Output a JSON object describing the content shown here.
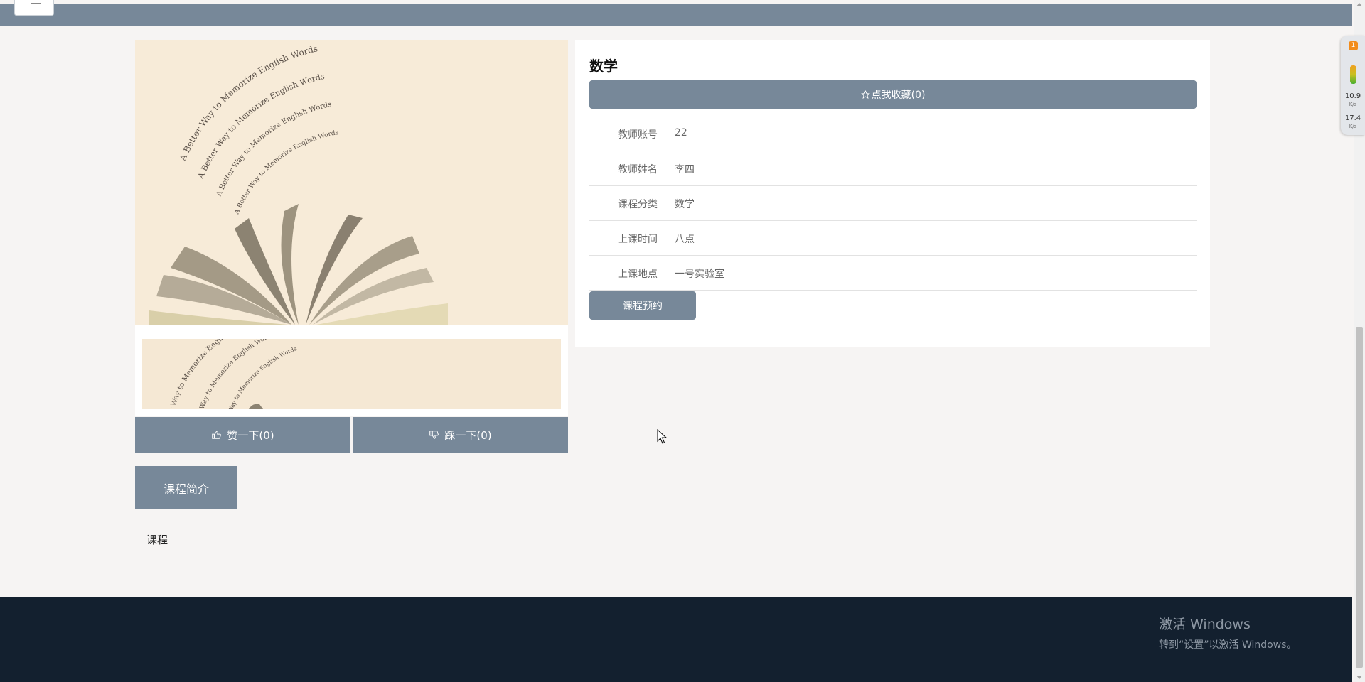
{
  "course": {
    "title": "数学",
    "favorite_label": "点我收藏(0)",
    "fields": [
      {
        "label": "教师账号",
        "value": "22"
      },
      {
        "label": "教师姓名",
        "value": "李四"
      },
      {
        "label": "课程分类",
        "value": "数学"
      },
      {
        "label": "上课时间",
        "value": "八点"
      },
      {
        "label": "上课地点",
        "value": "一号实验室"
      }
    ],
    "reserve_label": "课程预约"
  },
  "votes": {
    "like_label": "赞一下(0)",
    "dislike_label": "踩一下(0)"
  },
  "intro": {
    "tab_label": "课程简介",
    "content": "课程"
  },
  "image": {
    "caption_text": "A Better Way to Memorize English Words"
  },
  "watermark": {
    "line1": "激活 Windows",
    "line2": "转到“设置”以激活 Windows。"
  },
  "net_widget": {
    "badge": "1",
    "upload_speed": "10.9",
    "upload_unit": "K/s",
    "download_speed": "17.4",
    "download_unit": "K/s"
  },
  "colors": {
    "accent": "#778899",
    "page_bg": "#f6f4f3",
    "footer_bg": "#13202f",
    "panel_bg": "#ffffff"
  }
}
